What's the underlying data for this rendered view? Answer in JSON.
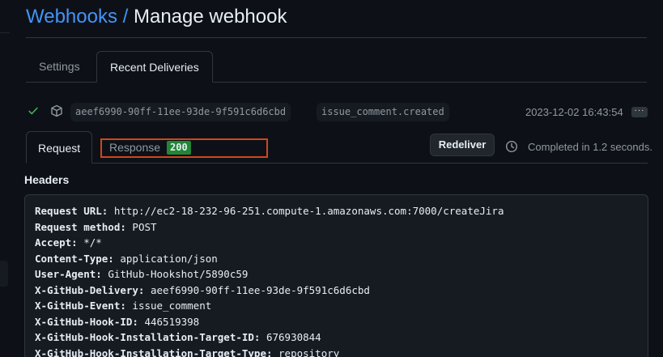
{
  "breadcrumb": {
    "parent": "Webhooks",
    "separator": "/",
    "current": "Manage webhook"
  },
  "tabs": [
    {
      "label": "Settings",
      "active": false
    },
    {
      "label": "Recent Deliveries",
      "active": true
    }
  ],
  "delivery": {
    "status_icon": "check-icon",
    "guid": "aeef6990-90ff-11ee-93de-9f591c6d6cbd",
    "event": "issue_comment.created",
    "timestamp": "2023-12-02 16:43:54",
    "more_label": "···"
  },
  "detail_tabs": {
    "request_label": "Request",
    "response_label": "Response",
    "response_code": "200",
    "active": "Request"
  },
  "redeliver_label": "Redeliver",
  "completed_text": "Completed in 1.2 seconds.",
  "headers_title": "Headers",
  "headers": [
    {
      "key": "Request URL:",
      "value": " http://ec2-18-232-96-251.compute-1.amazonaws.com:7000/createJira"
    },
    {
      "key": "Request method:",
      "value": " POST"
    },
    {
      "key": "Accept:",
      "value": " */*"
    },
    {
      "key": "Content-Type:",
      "value": " application/json"
    },
    {
      "key": "User-Agent:",
      "value": " GitHub-Hookshot/5890c59"
    },
    {
      "key": "X-GitHub-Delivery:",
      "value": " aeef6990-90ff-11ee-93de-9f591c6d6cbd"
    },
    {
      "key": "X-GitHub-Event:",
      "value": " issue_comment"
    },
    {
      "key": "X-GitHub-Hook-ID:",
      "value": " 446519398"
    },
    {
      "key": "X-GitHub-Hook-Installation-Target-ID:",
      "value": " 676930844"
    },
    {
      "key": "X-GitHub-Hook-Installation-Target-Type:",
      "value": " repository"
    }
  ],
  "colors": {
    "background": "#0d1117",
    "link": "#4493f8",
    "success": "#3fb950",
    "status_badge": "#238636",
    "highlight": "#d0461d"
  }
}
